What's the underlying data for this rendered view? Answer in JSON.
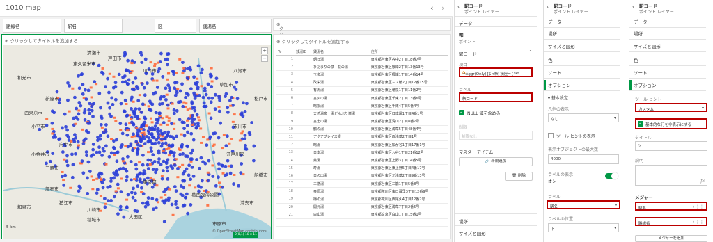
{
  "app": {
    "title": "1010 map",
    "nav_prev": "‹",
    "nav_next": "›"
  },
  "filters": [
    {
      "label": "路線名"
    },
    {
      "label": "駅名"
    },
    {
      "label": "区"
    },
    {
      "label": "銭湯名"
    }
  ],
  "right_title": "クリックしてタイトルを追加する",
  "map": {
    "title": "クリックしてタイトルを追加する",
    "scale": "5 km",
    "attribution": "© OpenStreetMap contributors",
    "labels": [
      "戸田市",
      "川口市",
      "和光市",
      "新座市",
      "西東京市",
      "清瀬市",
      "東久留米市",
      "小平市",
      "小金井市",
      "三鷹市",
      "調布市",
      "狛江市",
      "稲城市",
      "府中市",
      "東京都",
      "江戸川区",
      "浦安市",
      "市川市",
      "葛西臨海公園",
      "八潮市",
      "松戸市",
      "草加市",
      "川崎市",
      "大田区",
      "和泉市",
      "船橋市",
      "市原市"
    ],
    "status": [
      "0(0,1)",
      "18 x 11"
    ],
    "zoom_in": "+",
    "zoom_out": "−"
  },
  "table": {
    "title": "クリックしてタイトルを追加する",
    "columns": [
      "Te",
      "銭湯ID",
      "銭湯名",
      "住所"
    ],
    "rows": [
      [
        "1",
        "",
        "朝日湯",
        "東京都台東区谷中2丁目18番7号"
      ],
      [
        "2",
        "",
        "ひだまりの泉　萩の湯",
        "東京都台東区根岸2丁目13番13号"
      ],
      [
        "3",
        "",
        "玉泉湯",
        "東京都台東区根岸1丁目14番14号"
      ],
      [
        "4",
        "",
        "改栄湯",
        "東京都台東区三ノ輪2丁目12番15号"
      ],
      [
        "5",
        "",
        "有馬湯",
        "東京都台東区竜泉1丁目11番2号"
      ],
      [
        "6",
        "",
        "富久の湯",
        "東京都台東区千束2丁目13番6号"
      ],
      [
        "7",
        "",
        "曙銀湯",
        "東京都台東区千束4丁目5番4号"
      ],
      [
        "8",
        "",
        "天然温泉　湯どんぶり栄湯",
        "東京都台東区日本堤1丁目4番1号"
      ],
      [
        "9",
        "",
        "富士の湯",
        "東京都台東区清川2丁目8番7号"
      ],
      [
        "10",
        "",
        "鶴の湯",
        "東京都台東区浅草5丁目48番4号"
      ],
      [
        "11",
        "",
        "アクアプレイス銀",
        "東京都台東区西浅草2丁目1号"
      ],
      [
        "12",
        "",
        "曙湯",
        "東京都台東区松が谷1丁目17番1号"
      ],
      [
        "13",
        "",
        "日本湯",
        "東京都台東区入谷1丁目21番12号"
      ],
      [
        "14",
        "",
        "燕湯",
        "東京都台東区上野3丁目14番5号"
      ],
      [
        "15",
        "",
        "寿湯",
        "東京都台東区東上野5丁目4番17号"
      ],
      [
        "16",
        "",
        "日の出湯",
        "東京都台東区元浅草2丁目9番13号"
      ],
      [
        "17",
        "",
        "三筋湯",
        "東京都台東区三筋1丁目5番8号"
      ],
      [
        "18",
        "",
        "帝国湯",
        "東京都荒川区東日暮里3丁目12番9号"
      ],
      [
        "19",
        "",
        "梅の湯",
        "東京都荒川区西尾久4丁目12番2号"
      ],
      [
        "20",
        "",
        "開元湯",
        "東京都台東区浅草7丁目2番5号"
      ],
      [
        "21",
        "",
        "白山湯",
        "東京都文京区白山1丁目15番1号"
      ]
    ]
  },
  "prop1": {
    "title": "駅コード",
    "subtitle": "ポイント レイヤー",
    "tab_data": "データ",
    "section_field": "軸",
    "section_point": "ポイント",
    "dim_name": "駅コード",
    "item_label": "項目",
    "item_expr": "=Aggr(Only({$<駅_損座={\"*\"",
    "label_label": "ラベル",
    "label_value": "駅コード",
    "include_null": "NULL 値を含める",
    "limit_label": "制限",
    "limit_value": "制限なし",
    "master_label": "マスター アイテム",
    "add_new": "新規追加",
    "delete": "削除",
    "location": "場所",
    "size_shape": "サイズと図形"
  },
  "prop2": {
    "title": "駅コード",
    "subtitle": "ポイント レイヤー",
    "menu": [
      "データ",
      "場所",
      "サイズと図形",
      "色",
      "ソート",
      "オプション"
    ],
    "basic_settings": "基本設定",
    "legend_label": "凡例の表示",
    "legend_value": "なし",
    "tooltip_label": "ツール ヒントの表示",
    "max_objects_label": "表示オブジェクトの最大数",
    "max_objects_value": "4000",
    "show_labels_label": "ラベルの表示",
    "show_labels_value": "オン",
    "label_label": "ラベル",
    "label_value": "駅名",
    "label_pos_label": "ラベルの位置",
    "label_pos_value": "下"
  },
  "prop3": {
    "title": "駅コード",
    "subtitle": "ポイント レイヤー",
    "menu": [
      "データ",
      "場所",
      "サイズと図形",
      "色",
      "ソート",
      "オプション"
    ],
    "tooltip_label": "ツール ヒント",
    "tooltip_value": "カスタム",
    "hide_basic": "基本的な行を非表示にする",
    "title_label": "タイトル",
    "desc_label": "説明",
    "measures_label": "メジャー",
    "measure1": "駅名",
    "measure2": "路線名",
    "add_measure": "メジャーを追加"
  },
  "colors": {
    "accent": "#009845",
    "highlight": "#b00000",
    "blue_points": "#2b3fd8",
    "orange_points": "#ff6a3c"
  }
}
